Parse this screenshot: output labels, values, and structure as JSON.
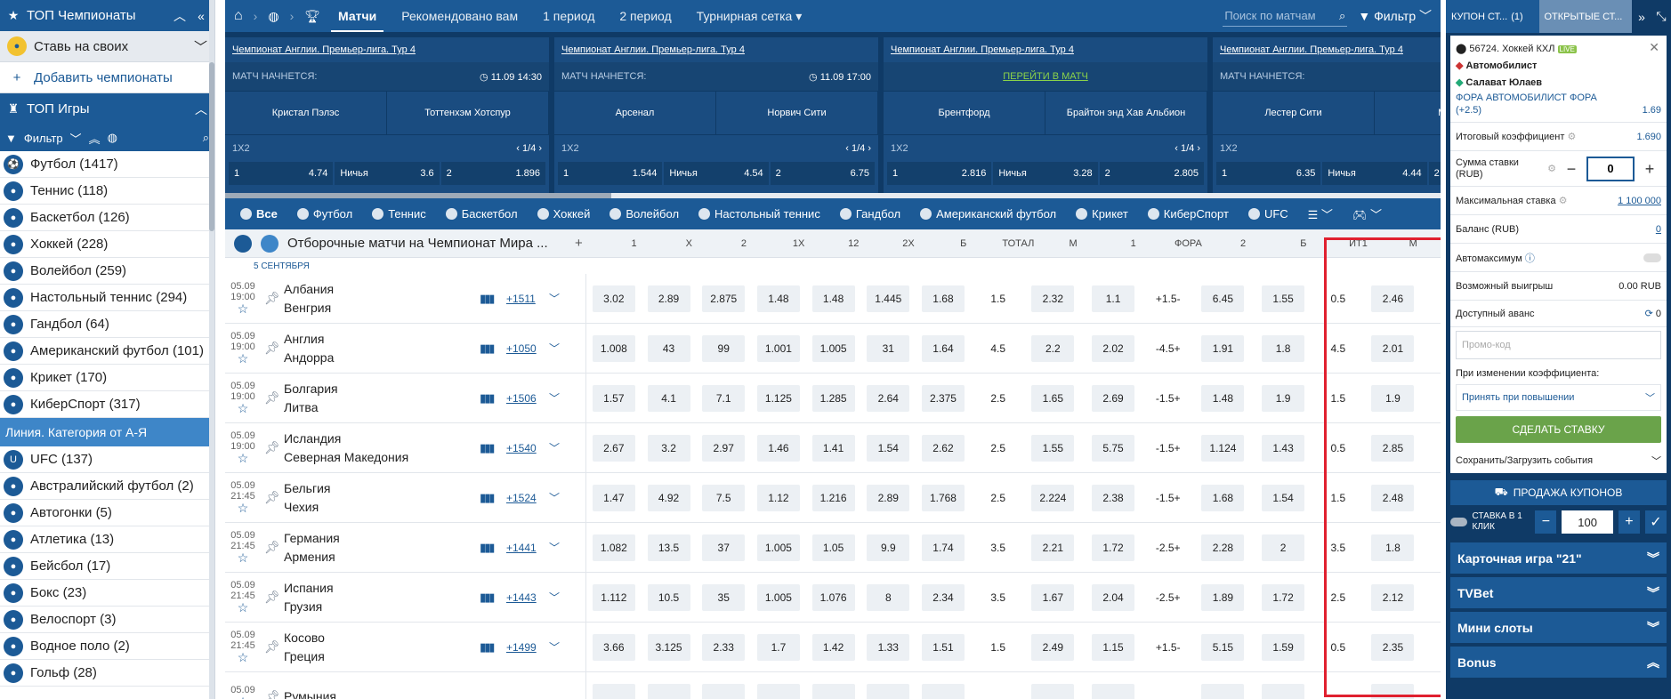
{
  "left": {
    "top_champ_title": "ТОП Чемпионаты",
    "bet_own": "Ставь на своих",
    "add_champ": "Добавить чемпионаты",
    "top_games": "ТОП Игры",
    "filter": "Фильтр",
    "sports": [
      {
        "label": "Футбол (1417)",
        "icon": "⚽"
      },
      {
        "label": "Теннис (118)",
        "icon": "●"
      },
      {
        "label": "Баскетбол (126)",
        "icon": "●"
      },
      {
        "label": "Хоккей (228)",
        "icon": "●"
      },
      {
        "label": "Волейбол (259)",
        "icon": "●"
      },
      {
        "label": "Настольный теннис (294)",
        "icon": "●"
      },
      {
        "label": "Гандбол (64)",
        "icon": "●"
      },
      {
        "label": "Американский футбол (101)",
        "icon": "●"
      },
      {
        "label": "Крикет (170)",
        "icon": "●"
      },
      {
        "label": "КиберСпорт (317)",
        "icon": "●"
      }
    ],
    "category_title": "Линия. Категория от А-Я",
    "cat_sports": [
      {
        "label": "UFC (137)",
        "icon": "U"
      },
      {
        "label": "Австралийский футбол (2)",
        "icon": "●"
      },
      {
        "label": "Автогонки (5)",
        "icon": "●"
      },
      {
        "label": "Атлетика (13)",
        "icon": "●"
      },
      {
        "label": "Бейсбол (17)",
        "icon": "●"
      },
      {
        "label": "Бокс (23)",
        "icon": "●"
      },
      {
        "label": "Велоспорт (3)",
        "icon": "●"
      },
      {
        "label": "Водное поло (2)",
        "icon": "●"
      },
      {
        "label": "Гольф (28)",
        "icon": "●"
      }
    ]
  },
  "topnav": {
    "items": [
      "Матчи",
      "Рекомендовано вам",
      "1 период",
      "2 период",
      "Турнирная сетка"
    ],
    "search_placeholder": "Поиск по матчам",
    "filter": "Фильтр"
  },
  "matches": [
    {
      "league": "Чемпионат Англии. Премьер-лига. Тур 4",
      "status": "МАТЧ НАЧНЕТСЯ:",
      "time": "11.09 14:30",
      "go": "",
      "t1": "Кристал Пэлэс",
      "t2": "Тоттенхэм Хотспур",
      "market": "1X2",
      "page": "1/4",
      "o1": "4.74",
      "draw_label": "Ничья",
      "ox": "3.6",
      "o2": "1.896"
    },
    {
      "league": "Чемпионат Англии. Премьер-лига. Тур 4",
      "status": "МАТЧ НАЧНЕТСЯ:",
      "time": "11.09 17:00",
      "go": "",
      "t1": "Арсенал",
      "t2": "Норвич Сити",
      "market": "1X2",
      "page": "1/4",
      "o1": "1.544",
      "draw_label": "Ничья",
      "ox": "4.54",
      "o2": "6.75"
    },
    {
      "league": "Чемпионат Англии. Премьер-лига. Тур 4",
      "status": "",
      "time": "",
      "go": "ПЕРЕЙТИ В МАТЧ",
      "t1": "Брентфорд",
      "t2": "Брайтон энд Хав Альбион",
      "market": "1X2",
      "page": "1/4",
      "o1": "2.816",
      "draw_label": "Ничья",
      "ox": "3.28",
      "o2": "2.805"
    },
    {
      "league": "Чемпионат Англии. Премьер-лига. Тур 4",
      "status": "МАТЧ НАЧНЕТСЯ:",
      "time": "",
      "go": "",
      "t1": "Лестер Сити",
      "t2": "Манчес",
      "market": "1X2",
      "page": "",
      "o1": "6.35",
      "draw_label": "Ничья",
      "ox": "4.44",
      "o2": ""
    }
  ],
  "sporttabs": [
    "Все",
    "Футбол",
    "Теннис",
    "Баскетбол",
    "Хоккей",
    "Волейбол",
    "Настольный теннис",
    "Гандбол",
    "Американский футбол",
    "Крикет",
    "КиберСпорт",
    "UFC"
  ],
  "table": {
    "title": "Отборочные матчи на Чемпионат Мира ...",
    "plus": "+",
    "columns": [
      "1",
      "X",
      "2",
      "1X",
      "12",
      "2X",
      "Б",
      "ТОТАЛ",
      "М",
      "1",
      "ФОРА",
      "2",
      "Б",
      "ИТ1",
      "М"
    ],
    "date": "5 СЕНТЯБРЯ",
    "rows": [
      {
        "d": "05.09",
        "t": "19:00",
        "a": "Албания",
        "b": "Венгрия",
        "more": "+1511",
        "odds": [
          "3.02",
          "2.89",
          "2.875",
          "1.48",
          "1.48",
          "1.445",
          "1.68",
          "1.5",
          "2.32",
          "1.1",
          "+1.5-",
          "6.45",
          "1.55",
          "0.5",
          "2.46"
        ]
      },
      {
        "d": "05.09",
        "t": "19:00",
        "a": "Англия",
        "b": "Андорра",
        "more": "+1050",
        "odds": [
          "1.008",
          "43",
          "99",
          "1.001",
          "1.005",
          "31",
          "1.64",
          "4.5",
          "2.2",
          "2.02",
          "-4.5+",
          "1.91",
          "1.8",
          "4.5",
          "2.01"
        ]
      },
      {
        "d": "05.09",
        "t": "19:00",
        "a": "Болгария",
        "b": "Литва",
        "more": "+1506",
        "odds": [
          "1.57",
          "4.1",
          "7.1",
          "1.125",
          "1.285",
          "2.64",
          "2.375",
          "2.5",
          "1.65",
          "2.69",
          "-1.5+",
          "1.48",
          "1.9",
          "1.5",
          "1.9"
        ]
      },
      {
        "d": "05.09",
        "t": "19:00",
        "a": "Исландия",
        "b": "Северная Македония",
        "more": "+1540",
        "odds": [
          "2.67",
          "3.2",
          "2.97",
          "1.46",
          "1.41",
          "1.54",
          "2.62",
          "2.5",
          "1.55",
          "5.75",
          "-1.5+",
          "1.124",
          "1.43",
          "0.5",
          "2.85"
        ]
      },
      {
        "d": "05.09",
        "t": "21:45",
        "a": "Бельгия",
        "b": "Чехия",
        "more": "+1524",
        "odds": [
          "1.47",
          "4.92",
          "7.5",
          "1.12",
          "1.216",
          "2.89",
          "1.768",
          "2.5",
          "2.224",
          "2.38",
          "-1.5+",
          "1.68",
          "1.54",
          "1.5",
          "2.48"
        ]
      },
      {
        "d": "05.09",
        "t": "21:45",
        "a": "Германия",
        "b": "Армения",
        "more": "+1441",
        "odds": [
          "1.082",
          "13.5",
          "37",
          "1.005",
          "1.05",
          "9.9",
          "1.74",
          "3.5",
          "2.21",
          "1.72",
          "-2.5+",
          "2.28",
          "2",
          "3.5",
          "1.8"
        ]
      },
      {
        "d": "05.09",
        "t": "21:45",
        "a": "Испания",
        "b": "Грузия",
        "more": "+1443",
        "odds": [
          "1.112",
          "10.5",
          "35",
          "1.005",
          "1.076",
          "8",
          "2.34",
          "3.5",
          "1.67",
          "2.04",
          "-2.5+",
          "1.89",
          "1.72",
          "2.5",
          "2.12"
        ]
      },
      {
        "d": "05.09",
        "t": "21:45",
        "a": "Косово",
        "b": "Греция",
        "more": "+1499",
        "odds": [
          "3.66",
          "3.125",
          "2.33",
          "1.7",
          "1.42",
          "1.33",
          "1.51",
          "1.5",
          "2.49",
          "1.15",
          "+1.5-",
          "5.15",
          "1.59",
          "0.5",
          "2.35"
        ]
      },
      {
        "d": "05.09",
        "t": "",
        "a": "Румыния",
        "b": "",
        "more": "",
        "odds": [
          "",
          "",
          "",
          "",
          "",
          "",
          "",
          "",
          "",
          "",
          "",
          "",
          "",
          "",
          ""
        ]
      }
    ]
  },
  "right": {
    "tab1": "КУПОН СТ...",
    "tab1_count": "(1)",
    "tab2": "ОТКРЫТЫЕ СТ...",
    "bet_event": "56724. Хоккей КХЛ",
    "live": "LIVE",
    "team1": "Автомобилист",
    "team2": "Салават Юлаев",
    "bet_market": "ФОРА АВТОМОБИЛИСТ ФОРА (+2.5)",
    "bet_odd": "1.69",
    "total_label": "Итоговый коэффициент",
    "total_value": "1.690",
    "stake_label": "Сумма ставки (RUB)",
    "stake_value": "0",
    "max_label": "Максимальная ставка",
    "max_value": "1 100 000",
    "balance_label": "Баланс (RUB)",
    "balance_value": "0",
    "automax_label": "Автомаксимум",
    "win_label": "Возможный выигрыш",
    "win_value": "0.00 RUB",
    "advance_label": "Доступный аванс",
    "advance_value": "0",
    "promo_placeholder": "Промо-код",
    "change_label": "При изменении коэффициента:",
    "change_value": "Принять при повышении",
    "make_bet": "СДЕЛАТЬ СТАВКУ",
    "save_load": "Сохранить/Загрузить события",
    "sale": "ПРОДАЖА КУПОНОВ",
    "oneclick_label": "СТАВКА В 1 КЛИК",
    "oneclick_value": "100",
    "accordions": [
      "Карточная игра \"21\"",
      "TVBet",
      "Мини слоты",
      "Bonus"
    ]
  }
}
